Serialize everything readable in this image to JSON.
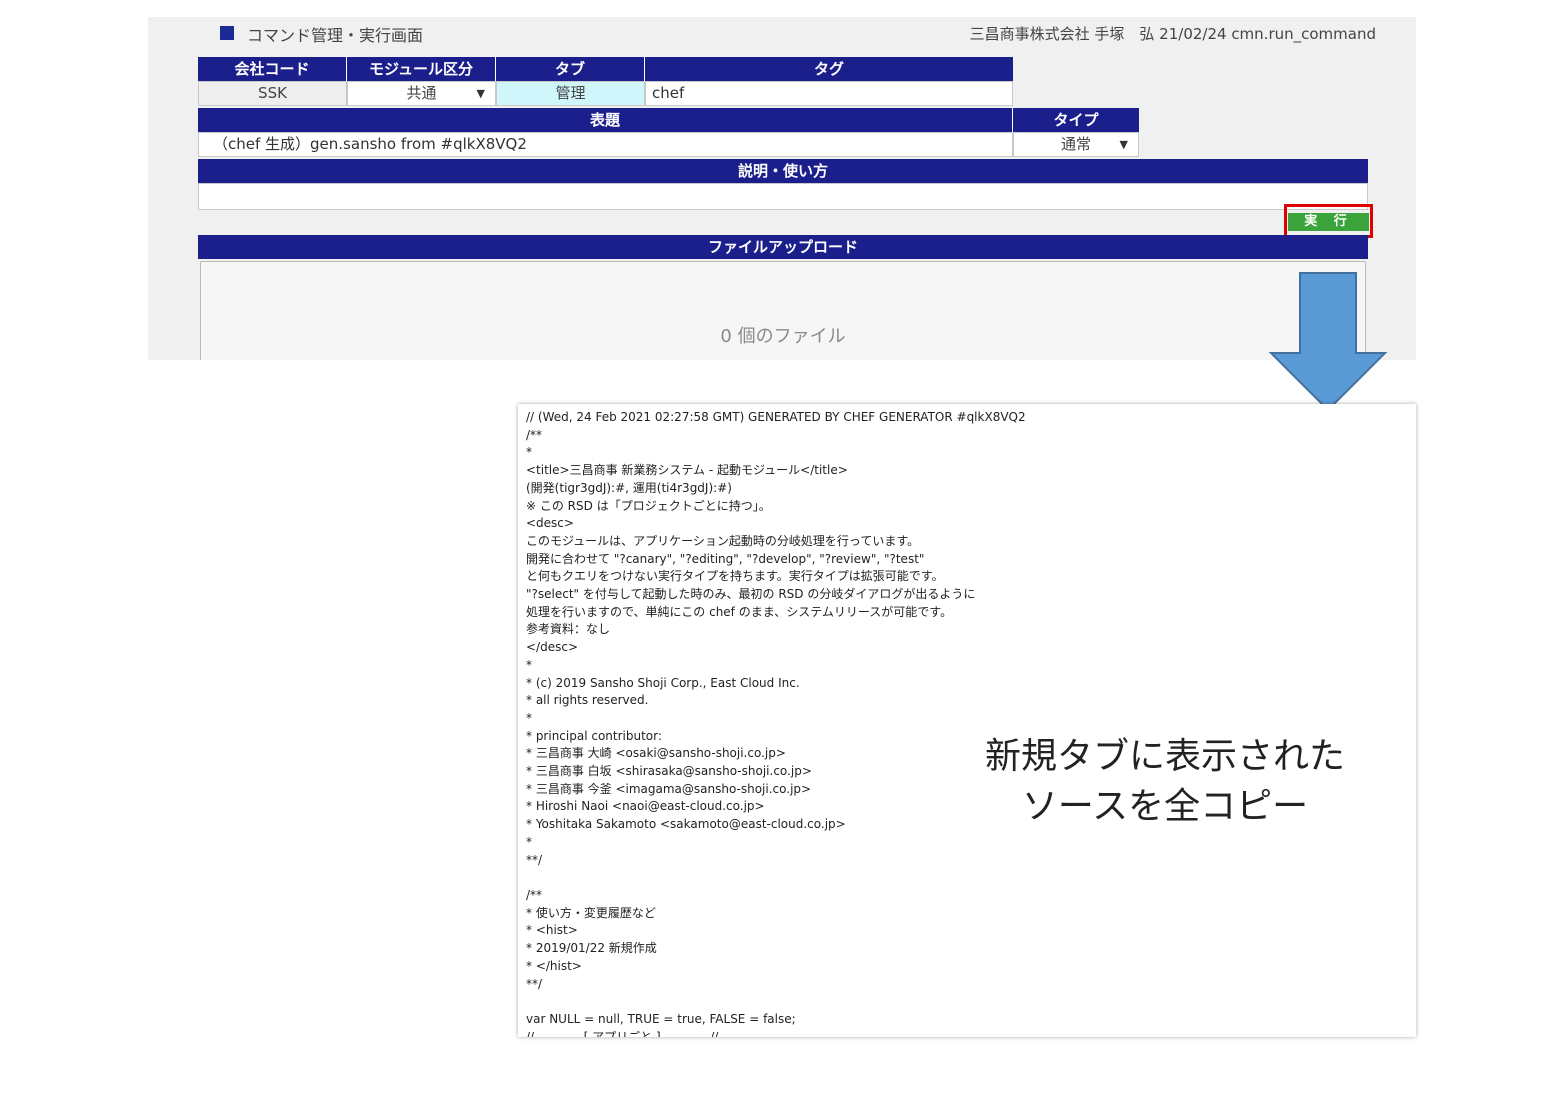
{
  "header": {
    "title": "コマンド管理・実行画面",
    "user_info": "三昌商事株式会社 手塚　弘 21/02/24 cmn.run_command"
  },
  "form": {
    "headers": {
      "company_code": "会社コード",
      "module_type": "モジュール区分",
      "tab": "タブ",
      "tag": "タグ",
      "subject": "表題",
      "type": "タイプ",
      "description": "説明・使い方",
      "file_upload": "ファイルアップロード"
    },
    "values": {
      "company_code": "SSK",
      "module_type": "共通",
      "tab": "管理",
      "tag": "chef",
      "subject": "（chef 生成）gen.sansho from #qlkX8VQ2",
      "type": "通常",
      "description": ""
    },
    "run_button": "実 行",
    "file_count": "0 個のファイル"
  },
  "arrow_color": "#5b9bd5",
  "highlight_color": "#e00000",
  "source_lines": [
    "// (Wed, 24 Feb 2021 02:27:58 GMT) GENERATED BY CHEF GENERATOR #qlkX8VQ2",
    "/**",
    "*",
    "<title>三昌商事 新業務システム - 起動モジュール</title>",
    "(開発(tigr3gdJ):#, 運用(ti4r3gdJ):#)",
    "※ この RSD は「プロジェクトごとに持つ」。",
    "<desc>",
    "このモジュールは、アプリケーション起動時の分岐処理を行っています。",
    "開発に合わせて \"?canary\", \"?editing\", \"?develop\", \"?review\", \"?test\"",
    "と何もクエリをつけない実行タイプを持ちます。実行タイプは拡張可能です。",
    "\"?select\" を付与して起動した時のみ、最初の RSD の分岐ダイアログが出るように",
    "処理を行いますので、単純にこの chef のまま、システムリリースが可能です。",
    "参考資料：なし",
    "</desc>",
    "*",
    "* (c) 2019 Sansho Shoji Corp., East Cloud Inc.",
    "* all rights reserved.",
    "*",
    "* principal contributor:",
    "* 三昌商事 大崎 <osaki@sansho-shoji.co.jp>",
    "* 三昌商事 白坂 <shirasaka@sansho-shoji.co.jp>",
    "* 三昌商事 今釜 <imagama@sansho-shoji.co.jp>",
    "* Hiroshi Naoi <naoi@east-cloud.co.jp>",
    "* Yoshitaka Sakamoto <sakamoto@east-cloud.co.jp>",
    "*",
    "**/",
    "",
    "/**",
    "* 使い方・変更履歴など",
    "* <hist>",
    "* 2019/01/22 新規作成",
    "* </hist>",
    "**/",
    "",
    "var NULL = null, TRUE = true, FALSE = false;",
    "//             [ アプリごと ]             //"
  ],
  "annotation": {
    "line1": "新規タブに表示された",
    "line2": "ソースを全コピー"
  }
}
